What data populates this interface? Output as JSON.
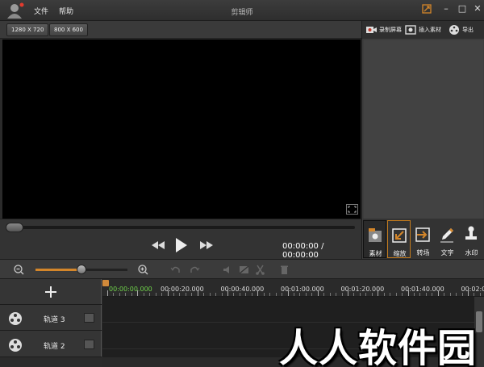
{
  "window": {
    "title": "剪辑师",
    "menu": [
      "文件",
      "帮助"
    ]
  },
  "resolution_presets": [
    "1280 X 720",
    "800 X 600"
  ],
  "right_panel": {
    "tabs": [
      {
        "label": "录制屏幕",
        "icon": "camera-icon"
      },
      {
        "label": "插入素材",
        "icon": "insert-media-icon"
      },
      {
        "label": "导出",
        "icon": "film-reel-icon"
      }
    ]
  },
  "playback": {
    "time_display": "00:00:00 / 00:00:00",
    "seek_progress": 0.0
  },
  "effects": [
    {
      "label": "素材",
      "icon": "media-library-icon",
      "active": true
    },
    {
      "label": "缩放",
      "icon": "zoom-arrow-icon",
      "active": false
    },
    {
      "label": "转场",
      "icon": "transition-icon",
      "active": false
    },
    {
      "label": "文字",
      "icon": "pencil-icon",
      "active": false
    },
    {
      "label": "水印",
      "icon": "stamp-icon",
      "active": false
    }
  ],
  "timeline": {
    "zoom_level": 0.5,
    "current_time": "00:00:00.000",
    "ruler_labels": [
      "00:00:20.000",
      "00:00:40.000",
      "00:01:00.000",
      "00:01:20.000",
      "00:01:40.000",
      "00:02:0"
    ],
    "tracks": [
      {
        "label": "轨道 3"
      },
      {
        "label": "轨道 2"
      }
    ]
  },
  "watermark_text": "人人软件园",
  "colors": {
    "accent": "#d4862a",
    "current_time": "#6fd34a"
  }
}
